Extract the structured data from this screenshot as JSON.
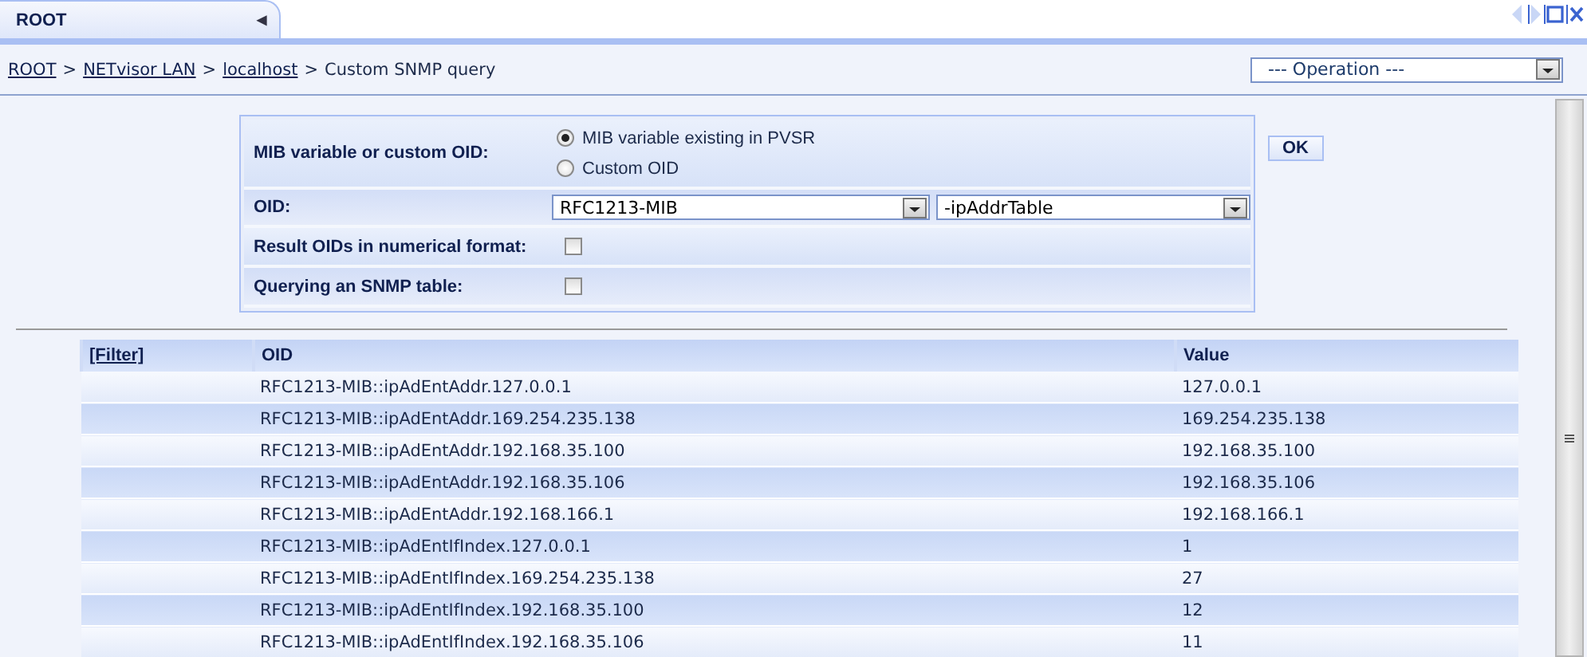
{
  "tab": {
    "label": "ROOT",
    "collapse_icon": "◀"
  },
  "breadcrumb": [
    {
      "label": "ROOT",
      "link": true
    },
    {
      "label": "NETvisor LAN",
      "link": true
    },
    {
      "label": "localhost",
      "link": true
    },
    {
      "label": "Custom SNMP query",
      "link": false
    }
  ],
  "breadcrumb_separator": ">",
  "operation_select": {
    "value": "--- Operation ---"
  },
  "form": {
    "rows": [
      {
        "kind": "radio",
        "label": "MIB variable or custom OID:",
        "options": [
          {
            "label": "MIB variable existing in PVSR",
            "selected": true
          },
          {
            "label": "Custom OID",
            "selected": false
          }
        ]
      },
      {
        "kind": "selects",
        "label": "OID:",
        "selects": [
          {
            "value": "RFC1213-MIB"
          },
          {
            "value": "-ipAddrTable"
          }
        ]
      },
      {
        "kind": "checkbox",
        "label": "Result OIDs in numerical format:",
        "checked": false
      },
      {
        "kind": "checkbox",
        "label": "Querying an SNMP table:",
        "checked": false
      }
    ]
  },
  "ok_button": "OK",
  "table": {
    "filter_link": "[Filter]",
    "columns": [
      "OID",
      "Value"
    ],
    "rows": [
      {
        "oid": "RFC1213-MIB::ipAdEntAddr.127.0.0.1",
        "value": "127.0.0.1"
      },
      {
        "oid": "RFC1213-MIB::ipAdEntAddr.169.254.235.138",
        "value": "169.254.235.138"
      },
      {
        "oid": "RFC1213-MIB::ipAdEntAddr.192.168.35.100",
        "value": "192.168.35.100"
      },
      {
        "oid": "RFC1213-MIB::ipAdEntAddr.192.168.35.106",
        "value": "192.168.35.106"
      },
      {
        "oid": "RFC1213-MIB::ipAdEntAddr.192.168.166.1",
        "value": "192.168.166.1"
      },
      {
        "oid": "RFC1213-MIB::ipAdEntIfIndex.127.0.0.1",
        "value": "1"
      },
      {
        "oid": "RFC1213-MIB::ipAdEntIfIndex.169.254.235.138",
        "value": "27"
      },
      {
        "oid": "RFC1213-MIB::ipAdEntIfIndex.192.168.35.100",
        "value": "12"
      },
      {
        "oid": "RFC1213-MIB::ipAdEntIfIndex.192.168.35.106",
        "value": "11"
      }
    ]
  }
}
